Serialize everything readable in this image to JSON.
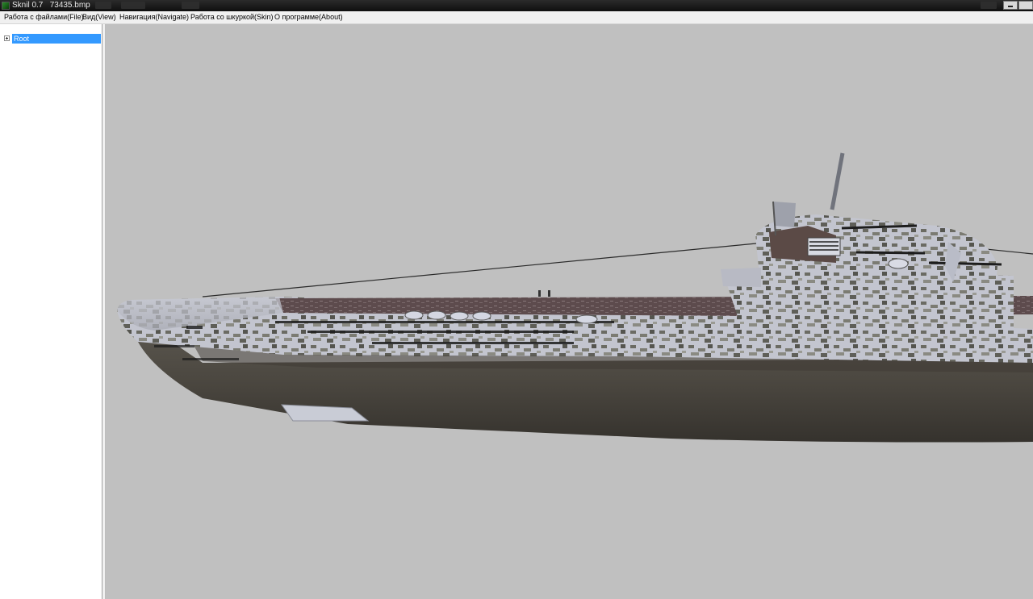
{
  "window": {
    "title": "Sknil 0.7   73435.bmp",
    "app_icon": "app-logo-icon"
  },
  "menu": {
    "items": [
      {
        "label": "Работа с файлами(File)"
      },
      {
        "label": "Вид(View)"
      },
      {
        "label": "Навигация(Navigate)"
      },
      {
        "label": "Работа со шкуркой(Skin)"
      },
      {
        "label": "О программе(About)"
      }
    ]
  },
  "tree": {
    "root_label": "Root",
    "expander_icon": "plus-box-icon",
    "selection_color": "#3399ff"
  },
  "viewport": {
    "background": "#c0c0c0",
    "model": "submarine hull with camouflage skin"
  }
}
